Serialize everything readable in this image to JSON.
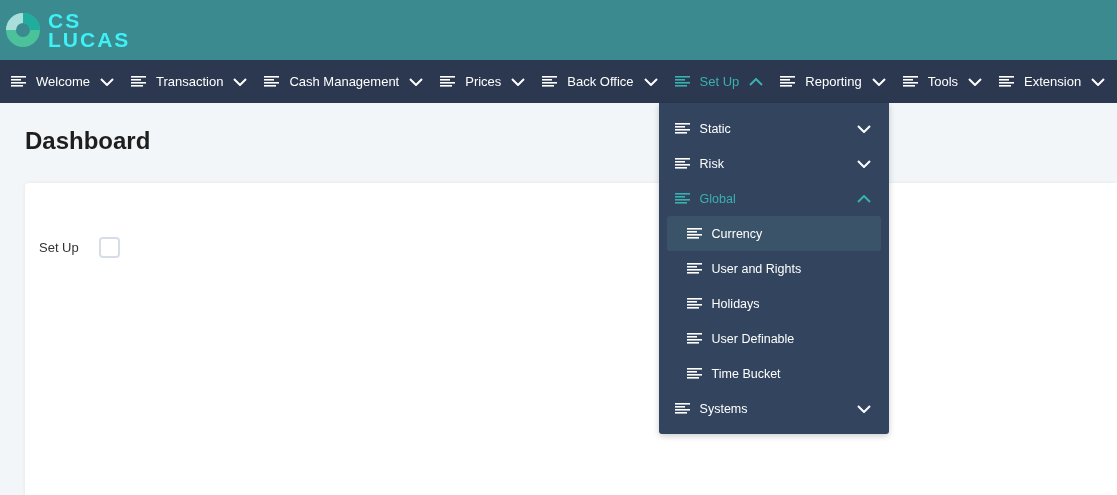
{
  "logo": {
    "line_1": "CS",
    "line_2": "LUCAS"
  },
  "nav": [
    {
      "label": "Welcome",
      "expanded": false
    },
    {
      "label": "Transaction",
      "expanded": false
    },
    {
      "label": "Cash Management",
      "expanded": false
    },
    {
      "label": "Prices",
      "expanded": false
    },
    {
      "label": "Back Office",
      "expanded": false
    },
    {
      "label": "Set Up",
      "expanded": true,
      "menu": [
        {
          "label": "Static",
          "expanded": false
        },
        {
          "label": "Risk",
          "expanded": false
        },
        {
          "label": "Global",
          "expanded": true,
          "children": [
            {
              "label": "Currency",
              "selected": true
            },
            {
              "label": "User and Rights",
              "selected": false
            },
            {
              "label": "Holidays",
              "selected": false
            },
            {
              "label": "User Definable",
              "selected": false
            },
            {
              "label": "Time Bucket",
              "selected": false
            }
          ]
        },
        {
          "label": "Systems",
          "expanded": false
        }
      ]
    },
    {
      "label": "Reporting",
      "expanded": false
    },
    {
      "label": "Tools",
      "expanded": false
    },
    {
      "label": "Extension",
      "expanded": false
    }
  ],
  "page_title": "Dashboard",
  "form": {
    "label": "Set Up",
    "checked": false
  }
}
